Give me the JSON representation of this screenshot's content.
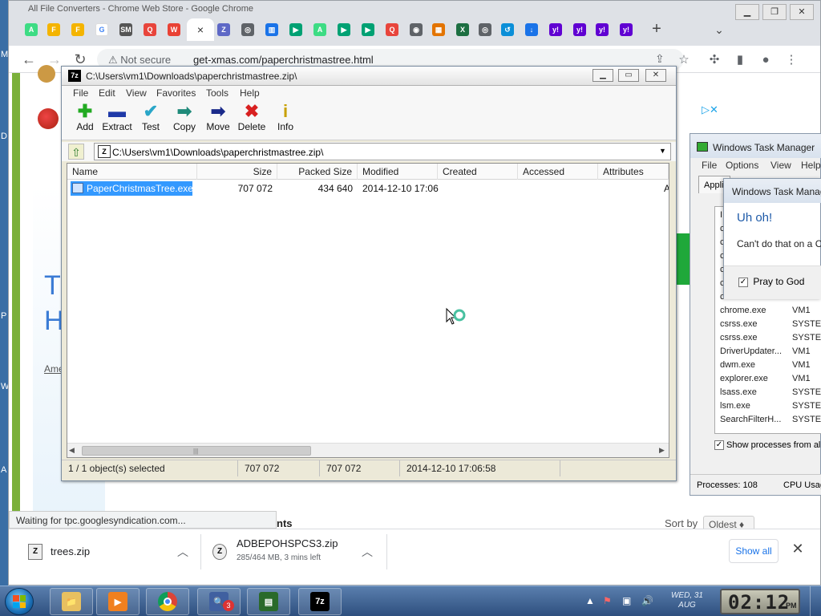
{
  "colors": {
    "chrome_tabbar": "#dee1e6",
    "accent_blue": "#1a73e8",
    "selection": "#3399ff",
    "site_green": "#7bb03a"
  },
  "desktop": {
    "edge_letters": [
      "M",
      "D",
      "P",
      "W",
      "A"
    ]
  },
  "chrome": {
    "window_title": "All File Converters - Chrome Web Store - Google Chrome",
    "tabs": [
      {
        "icon": "android-icon",
        "color": "#3ddc84",
        "glyph": "A"
      },
      {
        "icon": "folder-icon",
        "color": "#f4b400",
        "glyph": "F"
      },
      {
        "icon": "folder-icon",
        "color": "#f4b400",
        "glyph": "F"
      },
      {
        "icon": "google-icon",
        "color": "#ffffff",
        "glyph": "G"
      },
      {
        "icon": "sm-icon",
        "color": "#555555",
        "glyph": "SM"
      },
      {
        "icon": "record-icon",
        "color": "#e8453c",
        "glyph": "Q"
      },
      {
        "icon": "chrome-store-icon",
        "color": "#e94235",
        "glyph": "W"
      },
      {
        "icon": "active-tab-close",
        "color": "#ffffff",
        "glyph": "×"
      },
      {
        "icon": "app-icon",
        "color": "#5e68c6",
        "glyph": "Z"
      },
      {
        "icon": "globe-icon",
        "color": "#5f6368",
        "glyph": "◎"
      },
      {
        "icon": "layout-icon",
        "color": "#1a73e8",
        "glyph": "▥"
      },
      {
        "icon": "play-store-icon",
        "color": "#00a173",
        "glyph": "▶"
      },
      {
        "icon": "android-icon",
        "color": "#3ddc84",
        "glyph": "A"
      },
      {
        "icon": "play-store-icon",
        "color": "#00a173",
        "glyph": "▶"
      },
      {
        "icon": "play-store-icon",
        "color": "#00a173",
        "glyph": "▶"
      },
      {
        "icon": "record-icon",
        "color": "#e8453c",
        "glyph": "Q"
      },
      {
        "icon": "chrome-icon",
        "color": "#5f6368",
        "glyph": "◉"
      },
      {
        "icon": "grid-icon",
        "color": "#e37400",
        "glyph": "▦"
      },
      {
        "icon": "excel-icon",
        "color": "#1d6f42",
        "glyph": "X"
      },
      {
        "icon": "globe-icon",
        "color": "#5f6368",
        "glyph": "◎"
      },
      {
        "icon": "sync-icon",
        "color": "#0b8fd8",
        "glyph": "↺"
      },
      {
        "icon": "download-tab-icon",
        "color": "#1a73e8",
        "glyph": "↓"
      },
      {
        "icon": "yahoo-icon",
        "color": "#6001d2",
        "glyph": "y!"
      },
      {
        "icon": "yahoo-icon",
        "color": "#6001d2",
        "glyph": "y!"
      },
      {
        "icon": "yahoo-icon",
        "color": "#6001d2",
        "glyph": "y!"
      },
      {
        "icon": "yahoo-icon",
        "color": "#6001d2",
        "glyph": "y!"
      }
    ],
    "new_tab": "+",
    "tab_search": "⌄",
    "omnibox": {
      "security": "⚠ Not secure",
      "url": "get-xmas.com/paperchristmastree.html"
    },
    "page": {
      "heading_T": "Tr",
      "heading_H": "H",
      "link_text": "Ame",
      "comments_tail": "nts",
      "sort_label": "Sort by",
      "sort_value": "Oldest ♦",
      "ad_mark": "▷✕"
    },
    "status_bubble": "Waiting for tpc.googlesyndication.com...",
    "downloads": [
      {
        "name": "trees.zip",
        "sub": ""
      },
      {
        "name": "ADBEPOHSPCS3.zip",
        "sub": "285/464 MB, 3 mins left"
      }
    ],
    "show_all": "Show all",
    "shelf_close": "✕"
  },
  "sevenzip": {
    "title": "C:\\Users\\vm1\\Downloads\\paperchristmastree.zip\\",
    "title_icon": "7z",
    "menu": [
      "File",
      "Edit",
      "View",
      "Favorites",
      "Tools",
      "Help"
    ],
    "toolbar": [
      {
        "label": "Add",
        "glyph": "✚",
        "color": "#22aa22",
        "icon": "add-icon"
      },
      {
        "label": "Extract",
        "glyph": "▬",
        "color": "#1f3aa8",
        "icon": "extract-icon"
      },
      {
        "label": "Test",
        "glyph": "✔",
        "color": "#2aa6c8",
        "icon": "test-icon"
      },
      {
        "label": "Copy",
        "glyph": "➡",
        "color": "#1f8a7a",
        "icon": "copy-icon"
      },
      {
        "label": "Move",
        "glyph": "➡",
        "color": "#1a2a8a",
        "icon": "move-icon"
      },
      {
        "label": "Delete",
        "glyph": "✖",
        "color": "#d82020",
        "icon": "delete-icon"
      },
      {
        "label": "Info",
        "glyph": "i",
        "color": "#c8a000",
        "icon": "info-icon"
      }
    ],
    "address": "C:\\Users\\vm1\\Downloads\\paperchristmastree.zip\\",
    "columns": [
      "Name",
      "Size",
      "Packed Size",
      "Modified",
      "Created",
      "Accessed",
      "Attributes"
    ],
    "rows": [
      {
        "name": "PaperChristmasTree.exe",
        "size": "707 072",
        "packed": "434 640",
        "modified": "2014-12-10 17:06",
        "created": "",
        "accessed": "",
        "attr": "A"
      }
    ],
    "status": [
      "1 / 1 object(s) selected",
      "707 072",
      "707 072",
      "2014-12-10 17:06:58"
    ]
  },
  "taskmgr": {
    "title": "Windows Task Manager",
    "menu": [
      "File",
      "Options",
      "View",
      "Help"
    ],
    "tab": "Applications",
    "processes": [
      {
        "name": "I",
        "user": ""
      },
      {
        "name": "c",
        "user": ""
      },
      {
        "name": "c",
        "user": ""
      },
      {
        "name": "c",
        "user": ""
      },
      {
        "name": "c",
        "user": ""
      },
      {
        "name": "c",
        "user": ""
      },
      {
        "name": "chrome.exe",
        "user": "VM1"
      },
      {
        "name": "chrome.exe",
        "user": "VM1"
      },
      {
        "name": "csrss.exe",
        "user": "SYSTEM"
      },
      {
        "name": "csrss.exe",
        "user": "SYSTEM"
      },
      {
        "name": "DriverUpdater...",
        "user": "VM1"
      },
      {
        "name": "dwm.exe",
        "user": "VM1"
      },
      {
        "name": "explorer.exe",
        "user": "VM1"
      },
      {
        "name": "lsass.exe",
        "user": "SYSTEM"
      },
      {
        "name": "lsm.exe",
        "user": "SYSTEM"
      },
      {
        "name": "SearchFilterH...",
        "user": "SYSTEM"
      }
    ],
    "show_all": "Show processes from all users",
    "show_all_checked": "✓",
    "processes_count": "Processes: 108",
    "cpu": "CPU Usage"
  },
  "dialog": {
    "title": "Windows Task Manager",
    "heading": "Uh oh!",
    "message": "Can't do that on a C",
    "checkbox": "Pray to God",
    "checked": "✓"
  },
  "taskbar": {
    "apps": [
      {
        "name": "explorer",
        "glyph": "📁",
        "color": "#e8c060"
      },
      {
        "name": "media-player",
        "glyph": "▶",
        "color": "#f08020"
      },
      {
        "name": "chrome",
        "glyph": "",
        "color": ""
      },
      {
        "name": "search-tool",
        "glyph": "🔍",
        "color": "#4060a0"
      },
      {
        "name": "task-manager",
        "glyph": "▤",
        "color": "#2a6a2a"
      },
      {
        "name": "7zip",
        "glyph": "7z",
        "color": "#000000"
      }
    ],
    "badge": "3",
    "tray_icons": [
      "▲",
      "⚑",
      "▣",
      "🔊"
    ],
    "date_line1": "WED, 31",
    "date_line2": "AUG",
    "time": "02:12",
    "ampm": "PM"
  }
}
